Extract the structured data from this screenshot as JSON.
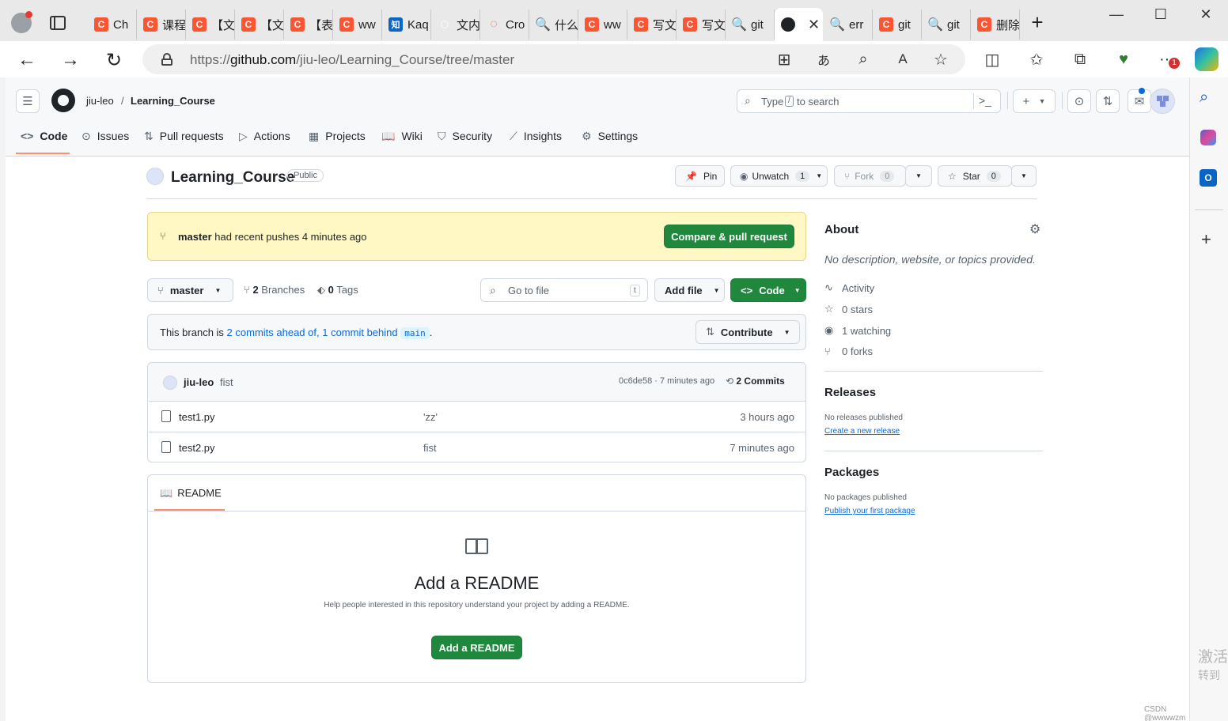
{
  "browser": {
    "tabs": [
      {
        "title": "Ch",
        "favicon": "csdn-icon",
        "fav_char": "C"
      },
      {
        "title": "课程",
        "favicon": "csdn-icon",
        "fav_char": "C"
      },
      {
        "title": "【文",
        "favicon": "csdn-icon",
        "fav_char": "C"
      },
      {
        "title": "【文",
        "favicon": "csdn-icon",
        "fav_char": "C"
      },
      {
        "title": "【表",
        "favicon": "csdn-icon",
        "fav_char": "C"
      },
      {
        "title": "ww",
        "favicon": "csdn-icon",
        "fav_char": "C"
      },
      {
        "title": "Kaq",
        "favicon": "zhihu-icon",
        "fav_char": "知"
      },
      {
        "title": "文内",
        "favicon": "hexagon-icon",
        "fav_char": "⬡"
      },
      {
        "title": "Cro",
        "favicon": "ring-icon",
        "fav_char": "◌"
      },
      {
        "title": "什么",
        "favicon": "search-icon",
        "fav_char": "🔍"
      },
      {
        "title": "ww",
        "favicon": "csdn-icon",
        "fav_char": "C"
      },
      {
        "title": "写文",
        "favicon": "csdn-icon",
        "fav_char": "C"
      },
      {
        "title": "写文",
        "favicon": "csdn-icon",
        "fav_char": "C"
      },
      {
        "title": "git",
        "favicon": "search-icon",
        "fav_char": "🔍"
      },
      {
        "title": "",
        "favicon": "github-icon",
        "fav_char": "",
        "active": true
      },
      {
        "title": "err",
        "favicon": "search-icon",
        "fav_char": "🔍"
      },
      {
        "title": "git",
        "favicon": "csdn-icon",
        "fav_char": "C"
      },
      {
        "title": "git",
        "favicon": "search-icon",
        "fav_char": "🔍"
      },
      {
        "title": "删除",
        "favicon": "csdn-icon",
        "fav_char": "C"
      }
    ],
    "url_prefix": "https://",
    "url_host": "github.com",
    "url_path": "/jiu-leo/Learning_Course/tree/master",
    "notification_badge": "1"
  },
  "gh": {
    "owner": "jiu-leo",
    "repo": "Learning_Course",
    "search_placeholder": "Type",
    "search_key": "/",
    "search_suffix": "to search",
    "nav": [
      {
        "label": "Code",
        "icon": "code-icon"
      },
      {
        "label": "Issues",
        "icon": "issue-icon"
      },
      {
        "label": "Pull requests",
        "icon": "pull-request-icon"
      },
      {
        "label": "Actions",
        "icon": "play-icon"
      },
      {
        "label": "Projects",
        "icon": "table-icon"
      },
      {
        "label": "Wiki",
        "icon": "book-icon"
      },
      {
        "label": "Security",
        "icon": "shield-icon"
      },
      {
        "label": "Insights",
        "icon": "graph-icon"
      },
      {
        "label": "Settings",
        "icon": "gear-icon"
      }
    ],
    "visibility": "Public",
    "pin_label": "Pin",
    "unwatch_label": "Unwatch",
    "unwatch_count": "1",
    "fork_label": "Fork",
    "fork_count": "0",
    "star_label": "Star",
    "star_count": "0",
    "banner_branch": "master",
    "banner_text": "had recent pushes 4 minutes ago",
    "compare_label": "Compare & pull request",
    "branch_label": "master",
    "branches_count": "2",
    "branches_label": "Branches",
    "tags_count": "0",
    "tags_label": "Tags",
    "goto_placeholder": "Go to file",
    "goto_key": "t",
    "addfile_label": "Add file",
    "code_label": "Code",
    "ahead_prefix": "This branch is",
    "ahead_link": "2 commits ahead of,",
    "behind_link": "1 commit behind",
    "base_branch": "main",
    "ahead_suffix": ".",
    "contribute_label": "Contribute",
    "commit_author": "jiu-leo",
    "commit_message": "fist",
    "commit_sha_time": "0c6de58 · 7 minutes ago",
    "commits_label": "2 Commits",
    "files": [
      {
        "name": "test1.py",
        "message": "'zz'",
        "time": "3 hours ago"
      },
      {
        "name": "test2.py",
        "message": "fist",
        "time": "7 minutes ago"
      }
    ],
    "readme_tab": "README",
    "readme_title": "Add a README",
    "readme_desc": "Help people interested in this repository understand your project by adding a README.",
    "readme_btn": "Add a README",
    "about_title": "About",
    "about_desc": "No description, website, or topics provided.",
    "about_items": [
      {
        "label": "Activity",
        "icon": "pulse-icon"
      },
      {
        "label": "0 stars",
        "icon": "star-icon"
      },
      {
        "label": "1 watching",
        "icon": "eye-icon"
      },
      {
        "label": "0 forks",
        "icon": "fork-icon"
      }
    ],
    "releases_title": "Releases",
    "releases_none": "No releases published",
    "releases_link": "Create a new release",
    "packages_title": "Packages",
    "packages_none": "No packages published",
    "packages_link": "Publish your first package"
  },
  "watermark": {
    "line1": "激活",
    "line2": "转到",
    "csdn": "CSDN @wwwwzm"
  }
}
